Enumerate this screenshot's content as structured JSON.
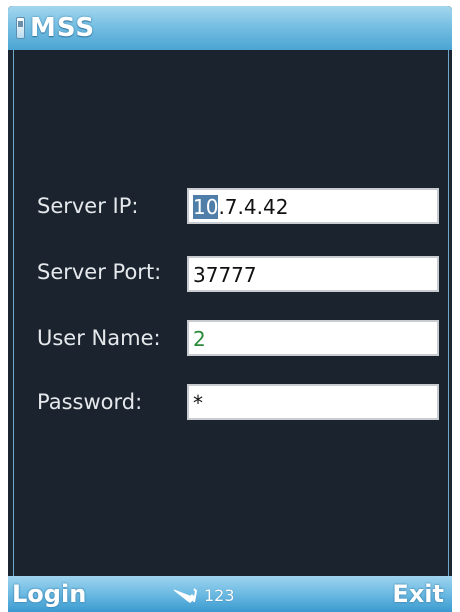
{
  "app": {
    "title": "MSS",
    "icon": "phone-app-icon"
  },
  "form": {
    "server_ip": {
      "label": "Server IP:",
      "value_selected": "10",
      "value_rest": ".7.4.42"
    },
    "server_port": {
      "label": "Server Port:",
      "value": "37777"
    },
    "user_name": {
      "label": "User Name:",
      "value": "2"
    },
    "password": {
      "label": "Password:",
      "value": "*"
    }
  },
  "softkeys": {
    "left": "Login",
    "right": "Exit",
    "input_mode": "123",
    "input_mode_icon": "pen-icon"
  },
  "colors": {
    "title_bar": "#7cc2e4",
    "background": "#1a232e",
    "selection": "#4f7fa8",
    "user_name_text": "#2b8a3a"
  }
}
